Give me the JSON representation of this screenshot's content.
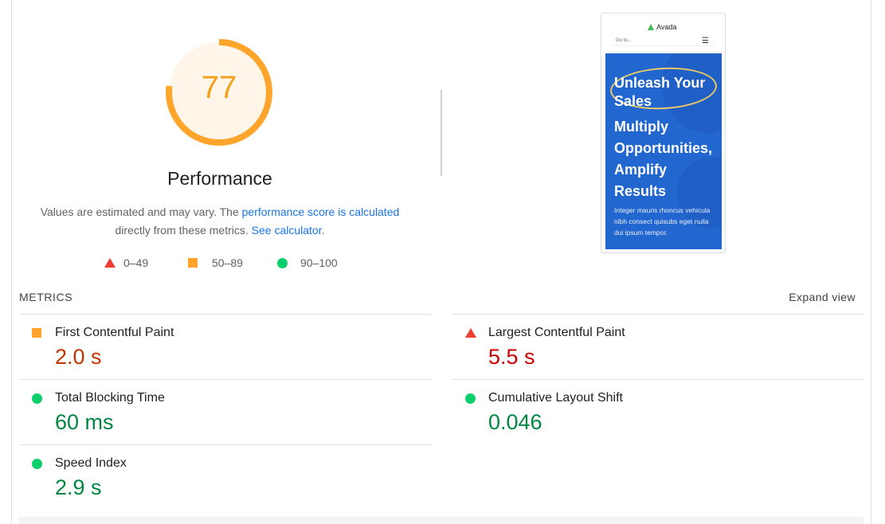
{
  "score": {
    "value": "77",
    "fraction": 0.77,
    "color": "#ffa400"
  },
  "title": "Performance",
  "description": {
    "text1": "Values are estimated and may vary. The ",
    "link1": "performance score is calculated",
    "text2": "directly from these metrics. ",
    "link2": "See calculator",
    "text3": "."
  },
  "legend": [
    {
      "label": "0–49",
      "icon": "red-triangle-icon"
    },
    {
      "label": "50–89",
      "icon": "orange-square-icon"
    },
    {
      "label": "90–100",
      "icon": "green-circle-icon"
    }
  ],
  "thumbnail": {
    "logo": "Avada",
    "search_placeholder": "Go to...",
    "lines": [
      "Unleash Your",
      "Sales",
      "Multiply",
      "Opportunities,",
      "Amplify",
      "Results"
    ],
    "small_text": "Integer mauris rhoncus vehicula nibh consect quisubs eget nulla dui ipsum tempor."
  },
  "metrics": {
    "title": "METRICS",
    "expand": "Expand view",
    "items": [
      {
        "label": "First Contentful Paint",
        "value": "2.0 s",
        "status": "average"
      },
      {
        "label": "Largest Contentful Paint",
        "value": "5.5 s",
        "status": "fail"
      },
      {
        "label": "Total Blocking Time",
        "value": "60 ms",
        "status": "pass"
      },
      {
        "label": "Cumulative Layout Shift",
        "value": "0.046",
        "status": "pass"
      },
      {
        "label": "Speed Index",
        "value": "2.9 s",
        "status": "pass"
      }
    ]
  },
  "colors": {
    "fail": "#eb3d34",
    "average": "#ffa32c",
    "pass": "#0cce6b",
    "link": "#1a73e8"
  }
}
